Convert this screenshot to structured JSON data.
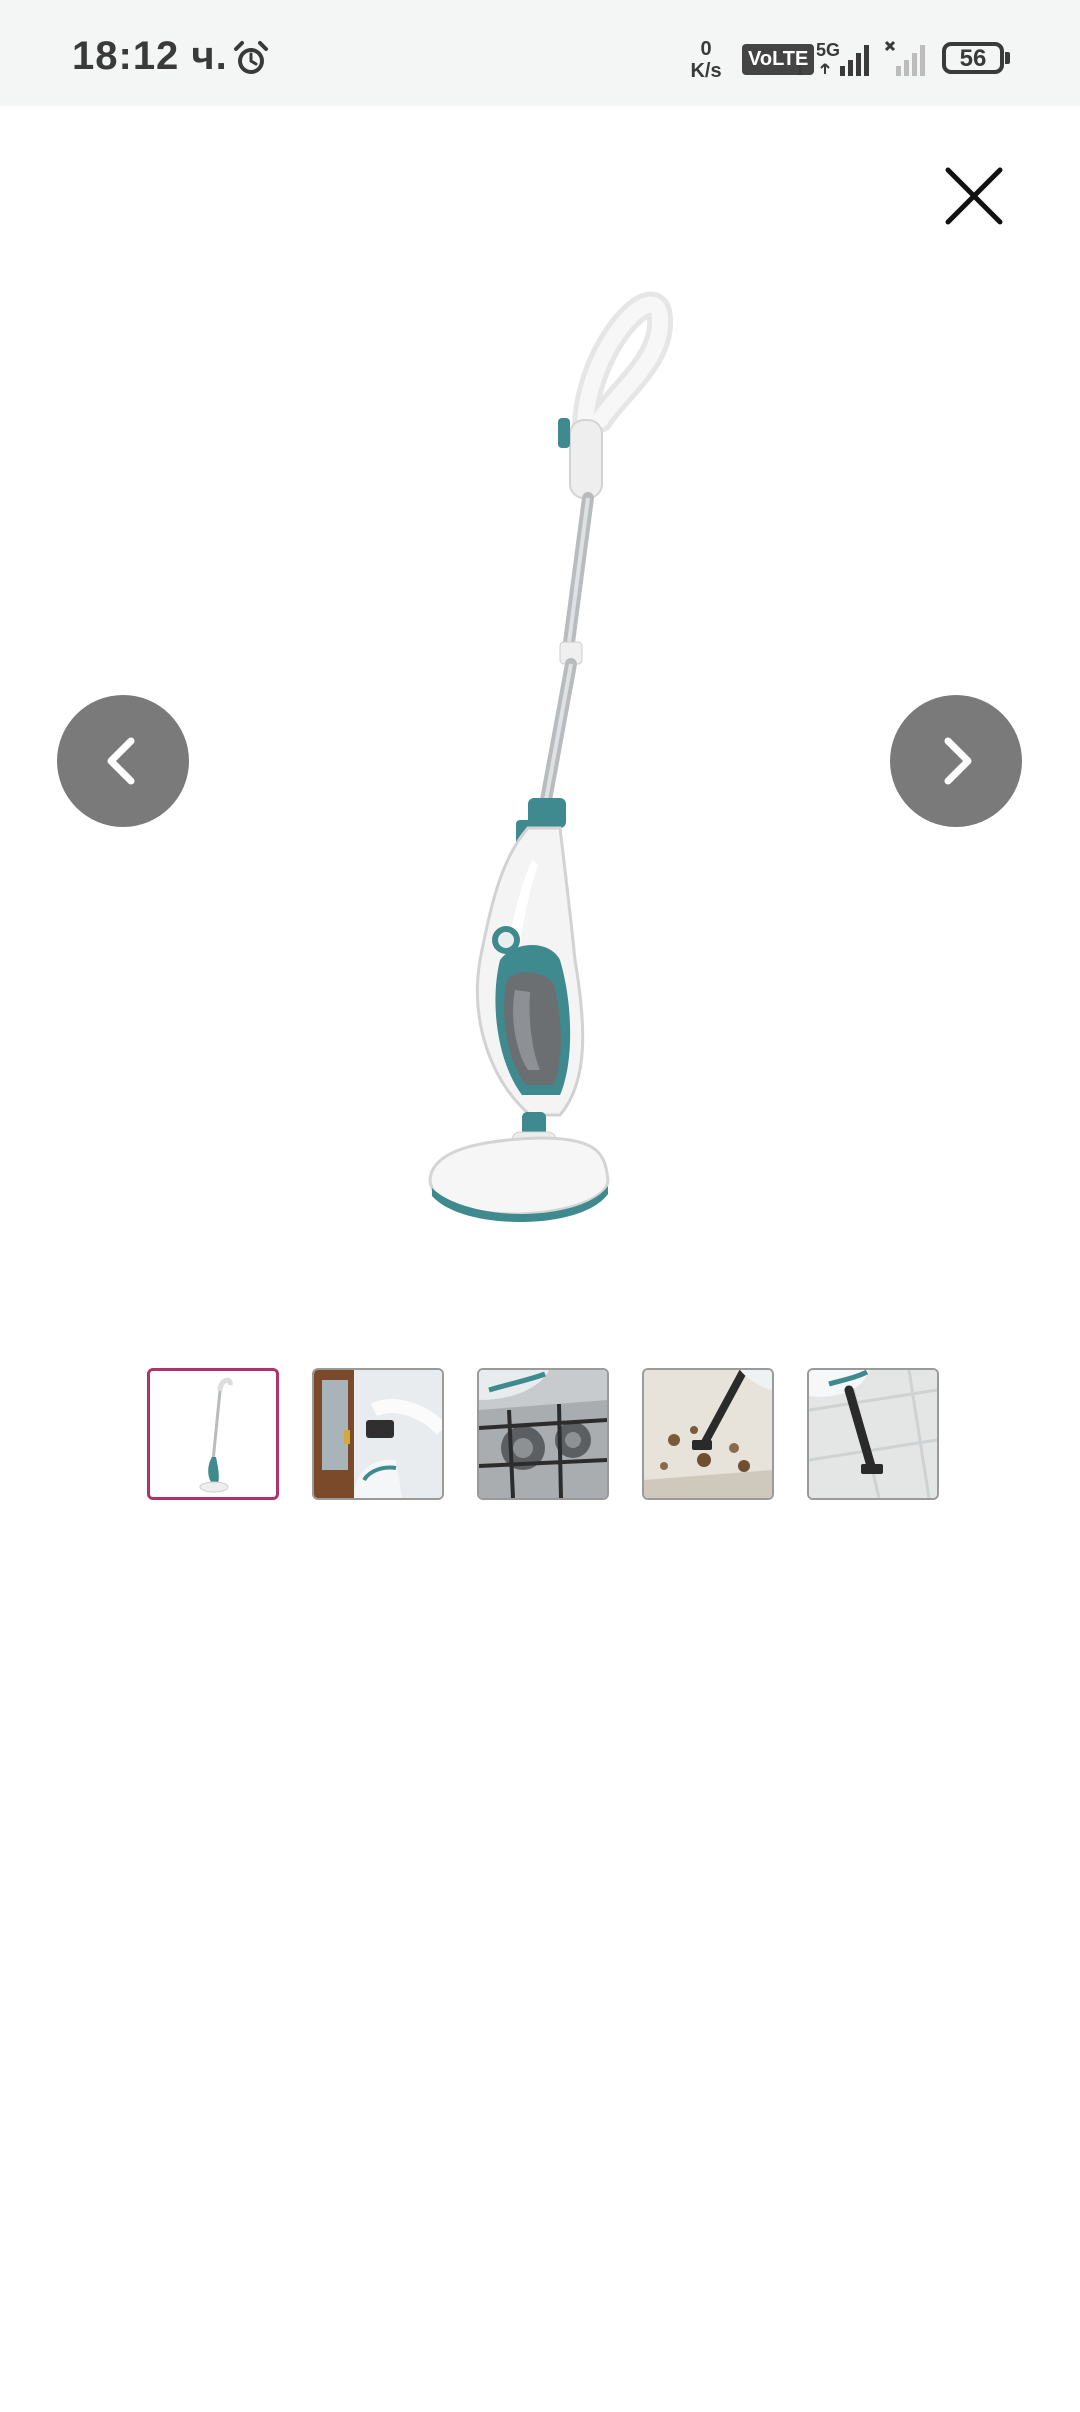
{
  "status_bar": {
    "time": "18:12 ч.",
    "speed_value": "0",
    "speed_unit": "K/s",
    "volte": "VoLTE",
    "volte_sub": "1",
    "network": "5G",
    "battery": "56",
    "icons": [
      "alarm-icon",
      "signal-icon",
      "signal-no-sim-icon",
      "battery-icon"
    ]
  },
  "viewer": {
    "close_icon": "close-icon",
    "prev_icon": "chevron-left-icon",
    "next_icon": "chevron-right-icon",
    "selected_index": 0,
    "thumbnail_count": 5
  },
  "colors": {
    "selected_border": "#b0326a",
    "nav_button": "#7a7a7a",
    "accent_teal": "#3f8a8e",
    "status_bar_bg": "#f3f6f5"
  }
}
